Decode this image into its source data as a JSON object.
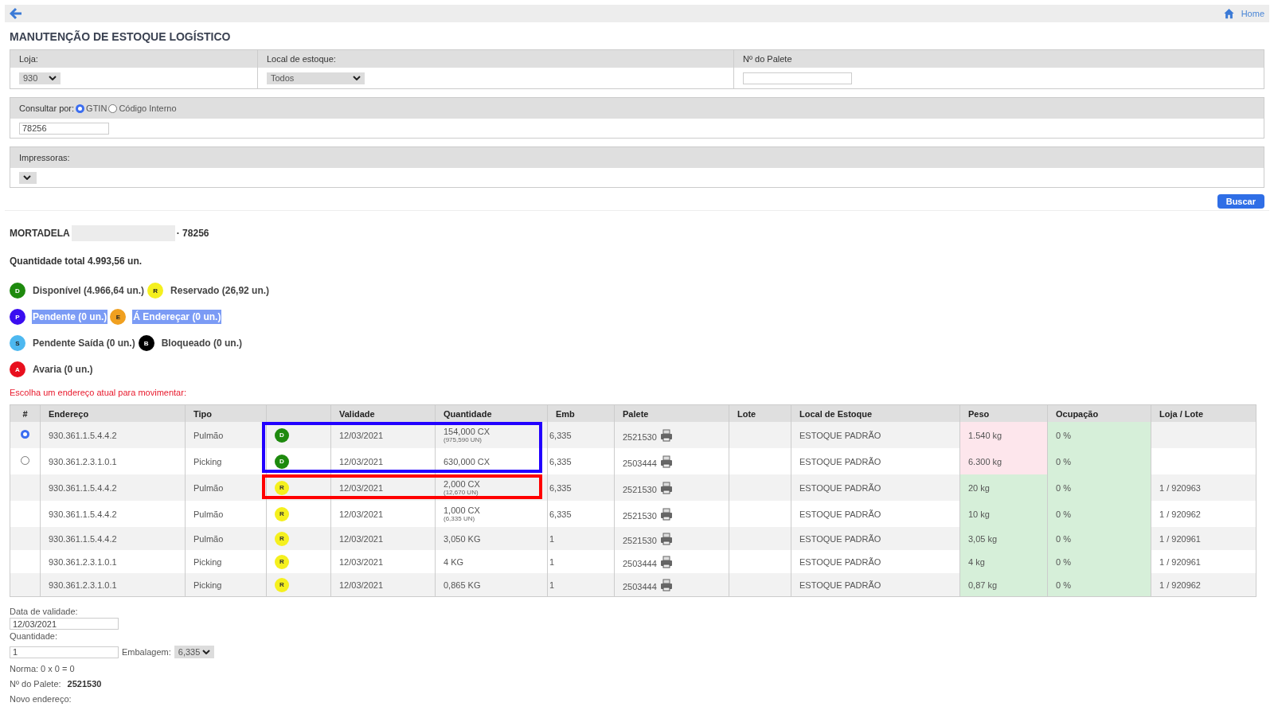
{
  "topbar": {
    "home_label": "Home"
  },
  "title": "MANUTENÇÃO DE ESTOQUE LOGÍSTICO",
  "filters": {
    "loja": {
      "label": "Loja:",
      "value": "930"
    },
    "local": {
      "label": "Local de estoque:",
      "value": "Todos"
    },
    "palete": {
      "label": "Nº do Palete"
    }
  },
  "consulta": {
    "label": "Consultar por:",
    "options": [
      {
        "label": "GTIN",
        "selected": true
      },
      {
        "label": "Código Interno",
        "selected": false
      }
    ],
    "value": "78256"
  },
  "impressoras": {
    "label": "Impressoras:"
  },
  "search_button": "Buscar",
  "product": {
    "name": "MORTADELA",
    "code": "· 78256",
    "total": "Quantidade total 4.993,56 un."
  },
  "legend": [
    [
      {
        "letter": "D",
        "label": "Disponível (4.966,64 un.)",
        "color": "#1e8a0e",
        "highlighted": false
      },
      {
        "letter": "R",
        "label": "Reservado (26,92 un.)",
        "color": "#f5f01e",
        "highlighted": false
      }
    ],
    [
      {
        "letter": "P",
        "label": "Pendente (0 un.)",
        "color": "#3a0df0",
        "highlighted": true
      },
      {
        "letter": "E",
        "label": "Á Endereçar (0 un.)",
        "color": "#f0a020",
        "highlighted": true
      }
    ],
    [
      {
        "letter": "S",
        "label": "Pendente Saída (0 un.)",
        "color": "#4db8f0",
        "highlighted": false
      },
      {
        "letter": "B",
        "label": "Bloqueado (0 un.)",
        "color": "#000000",
        "highlighted": false
      }
    ],
    [
      {
        "letter": "A",
        "label": "Avaria (0 un.)",
        "color": "#e8101e",
        "highlighted": false
      }
    ]
  ],
  "prompt": "Escolha um endereço atual para movimentar:",
  "table": {
    "columns": [
      "#",
      "Endereço",
      "Tipo",
      "",
      "Validade",
      "Quantidade",
      "Emb",
      "Palete",
      "Lote",
      "Local de Estoque",
      "Peso",
      "Ocupação",
      "Loja / Lote"
    ],
    "rows": [
      {
        "kind": "radio",
        "selected": true,
        "endereco": "930.361.1.5.4.4.2",
        "tipo": "Pulmão",
        "status": "D",
        "color": "#1e8a0e",
        "validade": "12/03/2021",
        "quantidade": "154,000 CX",
        "quantidade_un": "(975,590 UN)",
        "emb": "6,335",
        "palete": "2521530",
        "local": "ESTOQUE PADRÃO",
        "peso": "1.540 kg",
        "peso_alert": true,
        "ocupacao": "0 %",
        "frame": {
          "color": "#2200ff"
        }
      },
      {
        "kind": "radio",
        "selected": false,
        "endereco": "930.361.2.3.1.0.1",
        "tipo": "Picking",
        "status": "D",
        "color": "#1e8a0e",
        "validade": "12/03/2021",
        "quantidade": "630,000 CX",
        "emb": "6,335",
        "palete": "2503444",
        "local": "ESTOQUE PADRÃO",
        "peso": "6.300 kg",
        "peso_alert": true,
        "ocupacao": "0 %",
        "frame": {
          "color": "#2200ff"
        }
      },
      {
        "kind": "plain",
        "endereco": "930.361.1.5.4.4.2",
        "tipo": "Pulmão",
        "status": "R",
        "color": "#f5f01e",
        "validade": "12/03/2021",
        "quantidade": "2,000 CX",
        "quantidade_un": "(12,670 UN)",
        "emb": "6,335",
        "palete": "2521530",
        "local": "ESTOQUE PADRÃO",
        "peso": "20 kg",
        "peso_alert": false,
        "ocupacao": "0 %",
        "loja_lote": "1 / 920963",
        "frame": {
          "color": "#ff0000"
        }
      },
      {
        "kind": "plain",
        "endereco": "930.361.1.5.4.4.2",
        "tipo": "Pulmão",
        "status": "R",
        "color": "#f5f01e",
        "validade": "12/03/2021",
        "quantidade": "1,000 CX",
        "quantidade_un": "(6,335 UN)",
        "emb": "6,335",
        "palete": "2521530",
        "local": "ESTOQUE PADRÃO",
        "peso": "10 kg",
        "peso_alert": false,
        "ocupacao": "0 %",
        "loja_lote": "1 / 920962"
      },
      {
        "kind": "plain",
        "endereco": "930.361.1.5.4.4.2",
        "tipo": "Pulmão",
        "status": "R",
        "color": "#f5f01e",
        "validade": "12/03/2021",
        "quantidade": "3,050 KG",
        "emb": "1",
        "palete": "2521530",
        "local": "ESTOQUE PADRÃO",
        "peso": "3,05 kg",
        "peso_alert": false,
        "ocupacao": "0 %",
        "loja_lote": "1 / 920961"
      },
      {
        "kind": "plain",
        "endereco": "930.361.2.3.1.0.1",
        "tipo": "Picking",
        "status": "R",
        "color": "#f5f01e",
        "validade": "12/03/2021",
        "quantidade": "4 KG",
        "emb": "1",
        "palete": "2503444",
        "local": "ESTOQUE PADRÃO",
        "peso": "4 kg",
        "peso_alert": false,
        "ocupacao": "0 %",
        "loja_lote": "1 / 920961"
      },
      {
        "kind": "plain",
        "endereco": "930.361.2.3.1.0.1",
        "tipo": "Picking",
        "status": "R",
        "color": "#f5f01e",
        "validade": "12/03/2021",
        "quantidade": "0,865 KG",
        "emb": "1",
        "palete": "2503444",
        "local": "ESTOQUE PADRÃO",
        "peso": "0,87 kg",
        "peso_alert": false,
        "ocupacao": "0 %",
        "loja_lote": "1 / 920962"
      }
    ]
  },
  "form": {
    "validade_label": "Data de validade:",
    "validade_value": "12/03/2021",
    "quantidade_label": "Quantidade:",
    "quantidade_value": "1",
    "embalagem_label": "Embalagem:",
    "embalagem_value": "6,335",
    "norma": "Norma: 0 x 0 = 0",
    "palete_label": "Nº do Palete:",
    "palete_value": "2521530",
    "novo_label": "Novo endereço:"
  }
}
